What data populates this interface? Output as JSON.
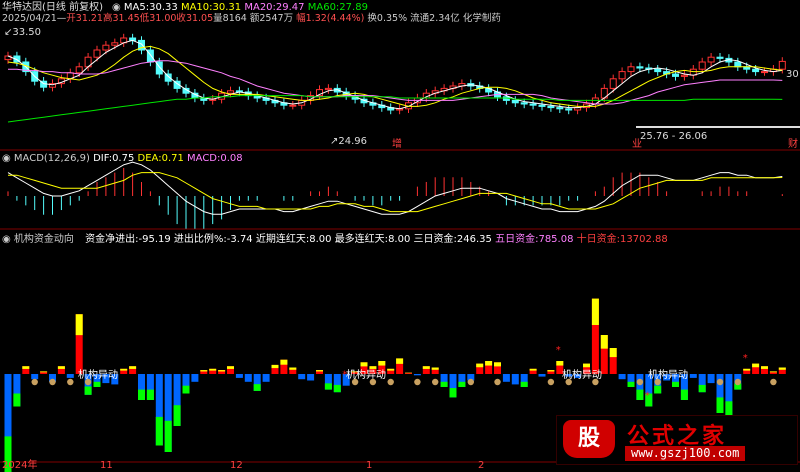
{
  "header": {
    "stock": "华特达因(日线 前复权)",
    "date": "2025/04/21",
    "open_label": "开",
    "open": "31.21",
    "high_label": "高",
    "high": "31.45",
    "low_label": "低",
    "low": "31.00",
    "close_label": "收",
    "close": "31.05",
    "vol_label": "量",
    "vol": "8164",
    "amount_label": "额",
    "amount": "2547万",
    "change_label": "幅",
    "change": "1.32(4.44%)",
    "turnover_label": "换",
    "turnover": "0.35%",
    "float_label": "流通",
    "float": "2.34亿",
    "sector": "化学制药"
  },
  "ma": {
    "ma5_label": "MA5:",
    "ma5": "30.33",
    "ma10_label": "MA10:",
    "ma10": "30.31",
    "ma20_label": "MA20:",
    "ma20": "29.47",
    "ma60_label": "MA60:",
    "ma60": "27.89"
  },
  "price_labels": {
    "high_mark": "33.50",
    "low_mark": "24.96",
    "range_mark": "25.76 - 26.06",
    "right_mark": "30",
    "tag_zeng": "增",
    "tag_ji": "业",
    "tag_cai": "财"
  },
  "macd": {
    "title": "MACD(12,26,9)",
    "dif_label": "DIF:",
    "dif": "0.75",
    "dea_label": "DEA:",
    "dea": "0.71",
    "macd_label": "MACD:",
    "macd": "0.08"
  },
  "fund": {
    "title": "机构资金动向",
    "net_label": "资金净进出:",
    "net": "-95.19",
    "ratio_label": "进出比例%:",
    "ratio": "-3.74",
    "streak_label": "近期连红天:",
    "streak": "8.00",
    "max_label": "最多连红天:",
    "max": "8.00",
    "d3_label": "三日资金:",
    "d3": "246.35",
    "d5_label": "五日资金:",
    "d5": "785.08",
    "d10_label": "十日资金:",
    "d10": "13702.88",
    "event_label": "机构异动"
  },
  "xaxis": {
    "year_label": "2024年",
    "m11": "11",
    "m12": "12",
    "m1": "1",
    "m2": "2"
  },
  "watermark": {
    "badge": "股",
    "name": "公式之家",
    "url": "www.gszj100.com"
  },
  "colors": {
    "up": "#ff3232",
    "down": "#54fcfc",
    "ma5": "#ffffff",
    "ma10": "#ffff00",
    "ma20": "#ff80ff",
    "ma60": "#00e600",
    "inflow_red": "#ff0000",
    "inflow_yellow": "#ffff00",
    "outflow_blue": "#0066ff",
    "outflow_green": "#00ff00"
  },
  "chart_data": [
    {
      "type": "candlestick",
      "series": [
        {
          "name": "MA5",
          "values": [
            31.5,
            31.2,
            30.6,
            29.8,
            29.2,
            29.1,
            29.3,
            29.6,
            29.9,
            30.6,
            31.2,
            31.8,
            32.2,
            32.6,
            32.8,
            32.5,
            31.6,
            30.6,
            29.8,
            29.2,
            28.7,
            28.3,
            28.0,
            27.9,
            28.1,
            28.3,
            28.5,
            28.4,
            28.2,
            28.0,
            27.8,
            27.6,
            27.5,
            27.6,
            27.9,
            28.3,
            28.6,
            28.7,
            28.4,
            28.1,
            27.8,
            27.6,
            27.4,
            27.2,
            27.1,
            27.3,
            27.7,
            28.1,
            28.4,
            28.6,
            28.8,
            29.0,
            29.1,
            29.0,
            28.8,
            28.5,
            28.2,
            27.9,
            27.7,
            27.6,
            27.5,
            27.4,
            27.3,
            27.2,
            27.2,
            27.3,
            27.5,
            28.0,
            28.6,
            29.2,
            29.8,
            30.2,
            30.4,
            30.5,
            30.4,
            30.2,
            30.0,
            29.9,
            30.1,
            30.6,
            31.0,
            31.2,
            31.1,
            30.8,
            30.5,
            30.3,
            30.2,
            30.3
          ]
        },
        {
          "name": "MA10",
          "values": [
            31.0,
            30.9,
            30.7,
            30.4,
            30.1,
            29.9,
            29.7,
            29.6,
            29.5,
            29.7,
            29.9,
            30.3,
            30.8,
            31.4,
            31.9,
            32.2,
            32.3,
            32.1,
            31.7,
            31.1,
            30.5,
            29.9,
            29.3,
            28.8,
            28.5,
            28.3,
            28.3,
            28.3,
            28.3,
            28.2,
            28.1,
            28.0,
            27.9,
            27.8,
            27.8,
            27.9,
            28.0,
            28.2,
            28.3,
            28.4,
            28.3,
            28.1,
            27.9,
            27.7,
            27.5,
            27.3,
            27.3,
            27.4,
            27.6,
            27.9,
            28.1,
            28.4,
            28.6,
            28.8,
            28.9,
            28.9,
            28.8,
            28.6,
            28.3,
            28.0,
            27.8,
            27.6,
            27.5,
            27.4,
            27.3,
            27.3,
            27.3,
            27.5,
            27.8,
            28.2,
            28.6,
            29.0,
            29.4,
            29.7,
            30.0,
            30.2,
            30.3,
            30.2,
            30.2,
            30.3,
            30.5,
            30.6,
            30.6,
            30.6,
            30.6,
            30.5,
            30.4,
            30.31
          ]
        },
        {
          "name": "MA20",
          "values": [
            30.4,
            30.4,
            30.3,
            30.3,
            30.2,
            30.2,
            30.1,
            30.1,
            30.0,
            30.0,
            30.0,
            30.1,
            30.3,
            30.5,
            30.7,
            30.9,
            31.0,
            31.1,
            31.1,
            31.0,
            30.9,
            30.7,
            30.5,
            30.3,
            30.1,
            29.8,
            29.6,
            29.3,
            29.0,
            28.8,
            28.6,
            28.4,
            28.3,
            28.2,
            28.1,
            28.1,
            28.1,
            28.1,
            28.2,
            28.2,
            28.2,
            28.2,
            28.1,
            28.0,
            27.9,
            27.8,
            27.8,
            27.8,
            27.8,
            27.8,
            27.8,
            27.9,
            28.0,
            28.1,
            28.2,
            28.3,
            28.3,
            28.3,
            28.3,
            28.3,
            28.2,
            28.0,
            27.9,
            27.8,
            27.7,
            27.6,
            27.5,
            27.5,
            27.5,
            27.6,
            27.8,
            28.0,
            28.2,
            28.5,
            28.7,
            28.9,
            29.1,
            29.2,
            29.3,
            29.4,
            29.5,
            29.5,
            29.5,
            29.5,
            29.5,
            29.5,
            29.5,
            29.47
          ]
        },
        {
          "name": "MA60",
          "values": [
            26.0,
            26.1,
            26.2,
            26.3,
            26.4,
            26.5,
            26.6,
            26.7,
            26.8,
            26.9,
            27.0,
            27.1,
            27.2,
            27.3,
            27.4,
            27.5,
            27.6,
            27.7,
            27.8,
            27.9,
            27.9,
            28.0,
            28.0,
            28.1,
            28.1,
            28.1,
            28.2,
            28.2,
            28.2,
            28.2,
            28.2,
            28.2,
            28.2,
            28.2,
            28.1,
            28.1,
            28.1,
            28.1,
            28.1,
            28.1,
            28.1,
            28.1,
            28.1,
            28.1,
            28.0,
            28.0,
            28.0,
            28.0,
            28.0,
            28.0,
            28.0,
            28.0,
            28.0,
            28.0,
            28.0,
            28.0,
            28.0,
            27.9,
            27.9,
            27.9,
            27.9,
            27.9,
            27.8,
            27.8,
            27.8,
            27.8,
            27.8,
            27.8,
            27.8,
            27.8,
            27.8,
            27.8,
            27.8,
            27.8,
            27.8,
            27.8,
            27.8,
            27.9,
            27.9,
            27.9,
            27.9,
            27.9,
            27.9,
            27.9,
            27.9,
            27.9,
            27.9,
            27.89
          ]
        }
      ],
      "close": [
        31.5,
        31.0,
        30.2,
        29.4,
        28.9,
        29.2,
        29.6,
        30.1,
        30.6,
        31.4,
        32.0,
        32.4,
        32.6,
        33.0,
        32.8,
        32.0,
        31.0,
        30.0,
        29.4,
        28.8,
        28.4,
        28.0,
        27.8,
        27.9,
        28.4,
        28.6,
        28.5,
        28.2,
        28.0,
        27.8,
        27.6,
        27.4,
        27.4,
        27.8,
        28.2,
        28.7,
        28.8,
        28.5,
        28.2,
        27.9,
        27.6,
        27.4,
        27.2,
        27.0,
        27.1,
        27.6,
        28.0,
        28.4,
        28.6,
        28.8,
        29.0,
        29.2,
        29.0,
        28.8,
        28.5,
        28.1,
        27.8,
        27.6,
        27.5,
        27.4,
        27.3,
        27.2,
        27.1,
        27.0,
        27.2,
        27.5,
        28.0,
        28.8,
        29.6,
        30.2,
        30.6,
        30.5,
        30.4,
        30.2,
        30.0,
        29.8,
        29.9,
        30.4,
        31.0,
        31.4,
        31.3,
        31.0,
        30.6,
        30.4,
        30.2,
        30.2,
        30.4,
        31.05
      ],
      "ylim": [
        24,
        34
      ]
    },
    {
      "type": "line",
      "series": [
        {
          "name": "DIF",
          "values": [
            0.9,
            0.7,
            0.5,
            0.3,
            0.1,
            0.0,
            0.0,
            0.1,
            0.2,
            0.4,
            0.6,
            0.8,
            1.0,
            1.2,
            1.3,
            1.2,
            1.0,
            0.7,
            0.4,
            0.1,
            -0.2,
            -0.4,
            -0.6,
            -0.7,
            -0.7,
            -0.6,
            -0.5,
            -0.5,
            -0.5,
            -0.5,
            -0.5,
            -0.6,
            -0.6,
            -0.5,
            -0.4,
            -0.3,
            -0.2,
            -0.2,
            -0.3,
            -0.4,
            -0.5,
            -0.6,
            -0.7,
            -0.7,
            -0.7,
            -0.6,
            -0.4,
            -0.2,
            0.0,
            0.1,
            0.2,
            0.3,
            0.3,
            0.3,
            0.2,
            0.1,
            -0.1,
            -0.2,
            -0.3,
            -0.4,
            -0.5,
            -0.5,
            -0.6,
            -0.6,
            -0.6,
            -0.5,
            -0.4,
            -0.2,
            0.1,
            0.4,
            0.6,
            0.8,
            0.8,
            0.8,
            0.7,
            0.6,
            0.6,
            0.6,
            0.7,
            0.8,
            0.9,
            0.9,
            0.8,
            0.8,
            0.7,
            0.7,
            0.7,
            0.75
          ]
        },
        {
          "name": "DEA",
          "values": [
            0.8,
            0.8,
            0.7,
            0.6,
            0.5,
            0.4,
            0.3,
            0.3,
            0.3,
            0.3,
            0.3,
            0.4,
            0.5,
            0.6,
            0.8,
            0.9,
            0.9,
            0.9,
            0.8,
            0.7,
            0.5,
            0.3,
            0.1,
            -0.1,
            -0.2,
            -0.3,
            -0.4,
            -0.4,
            -0.4,
            -0.5,
            -0.5,
            -0.5,
            -0.5,
            -0.5,
            -0.5,
            -0.4,
            -0.4,
            -0.3,
            -0.3,
            -0.3,
            -0.4,
            -0.4,
            -0.5,
            -0.6,
            -0.6,
            -0.6,
            -0.6,
            -0.5,
            -0.4,
            -0.3,
            -0.2,
            -0.1,
            0.0,
            0.1,
            0.1,
            0.1,
            0.1,
            0.0,
            -0.1,
            -0.2,
            -0.3,
            -0.3,
            -0.4,
            -0.5,
            -0.5,
            -0.5,
            -0.5,
            -0.4,
            -0.3,
            -0.1,
            0.1,
            0.3,
            0.4,
            0.5,
            0.6,
            0.6,
            0.6,
            0.6,
            0.6,
            0.7,
            0.7,
            0.7,
            0.7,
            0.7,
            0.7,
            0.7,
            0.7,
            0.71
          ]
        }
      ]
    },
    {
      "type": "bar",
      "series": [
        {
          "name": "资金净进出",
          "values": [
            -80,
            -25,
            6,
            -4,
            2,
            -6,
            6,
            -3,
            46,
            -16,
            -10,
            -7,
            -8,
            4,
            6,
            -20,
            -20,
            -55,
            -60,
            -40,
            -15,
            -6,
            3,
            4,
            3,
            6,
            -3,
            -6,
            -13,
            -6,
            7,
            11,
            5,
            -4,
            -5,
            3,
            -12,
            -14,
            -9,
            2,
            9,
            6,
            10,
            4,
            12,
            1,
            -1,
            6,
            5,
            -10,
            -18,
            -10,
            -5,
            8,
            10,
            9,
            -6,
            -8,
            -10,
            4,
            -2,
            3,
            10,
            -2,
            -3,
            8,
            58,
            30,
            20,
            -4,
            -10,
            -20,
            -25,
            -15,
            -5,
            -10,
            -20,
            -3,
            -14,
            -7,
            -30,
            -35,
            -12,
            4,
            8,
            6,
            2,
            5
          ]
        }
      ]
    }
  ]
}
